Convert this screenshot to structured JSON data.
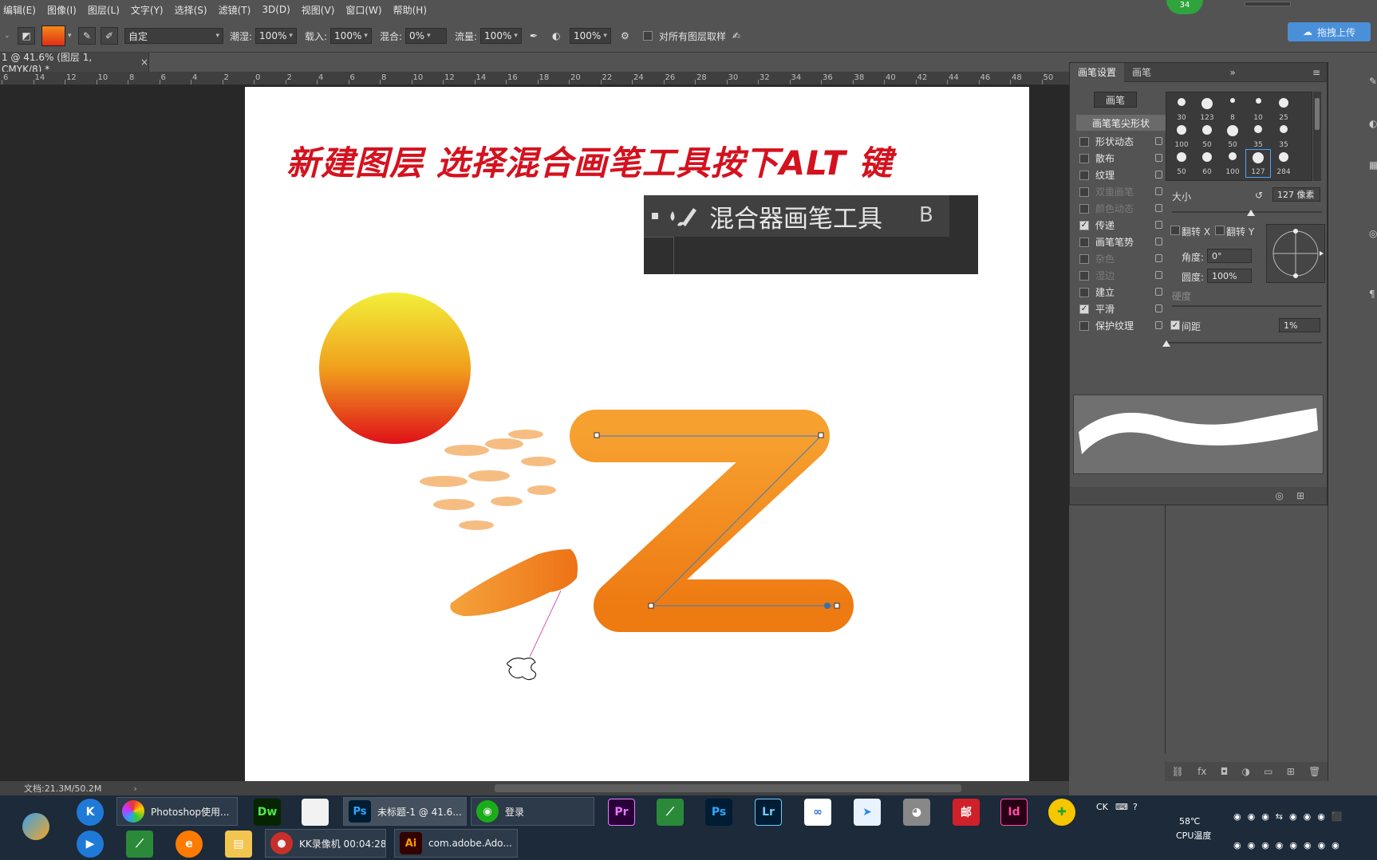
{
  "menu": [
    "编辑(E)",
    "图像(I)",
    "图层(L)",
    "文字(Y)",
    "选择(S)",
    "滤镜(T)",
    "3D(D)",
    "视图(V)",
    "窗口(W)",
    "帮助(H)"
  ],
  "net_badge": "34",
  "options": {
    "preset": "自定",
    "wet_label": "潮湿:",
    "wet_value": "100%",
    "load_label": "载入:",
    "load_value": "100%",
    "mix_label": "混合:",
    "mix_value": "0%",
    "flow_label": "流量:",
    "flow_value": "100%",
    "extra_value": "100%",
    "sample_all_label": "对所有图层取样",
    "upload_label": "拖拽上传"
  },
  "doc_tab": {
    "title": "1 @ 41.6% (图层 1, CMYK/8) *",
    "close": "×"
  },
  "ruler": [
    "6",
    "14",
    "12",
    "10",
    "8",
    "6",
    "4",
    "2",
    "0",
    "2",
    "4",
    "6",
    "8",
    "10",
    "12",
    "14",
    "16",
    "18",
    "20",
    "22",
    "24",
    "26",
    "28",
    "30",
    "32",
    "34",
    "36",
    "38",
    "40",
    "42",
    "44",
    "46",
    "48",
    "50"
  ],
  "canvas": {
    "headline": "新建图层   选择混合画笔工具按下ALT 键",
    "tooltip_label": "混合器画笔工具",
    "tooltip_key": "B"
  },
  "status": {
    "doc_size": "文档:21.3M/50.2M",
    "arrow": "›"
  },
  "brush_panel": {
    "tabs": [
      "画笔设置",
      "画笔"
    ],
    "preset_button": "画笔",
    "tip_shape": "画笔笔尖形状",
    "options": [
      {
        "label": "形状动态",
        "checked": false,
        "dim": false
      },
      {
        "label": "散布",
        "checked": false,
        "dim": false
      },
      {
        "label": "纹理",
        "checked": false,
        "dim": false
      },
      {
        "label": "双重画笔",
        "checked": false,
        "dim": true
      },
      {
        "label": "颜色动态",
        "checked": false,
        "dim": true
      },
      {
        "label": "传递",
        "checked": true,
        "dim": false
      },
      {
        "label": "画笔笔势",
        "checked": false,
        "dim": false
      },
      {
        "label": "杂色",
        "checked": false,
        "dim": true
      },
      {
        "label": "湿边",
        "checked": false,
        "dim": true
      },
      {
        "label": "建立",
        "checked": false,
        "dim": false
      },
      {
        "label": "平滑",
        "checked": true,
        "dim": false
      },
      {
        "label": "保护纹理",
        "checked": false,
        "dim": false
      }
    ],
    "presets": [
      "30",
      "123",
      "8",
      "10",
      "25",
      "100",
      "50",
      "50",
      "35",
      "35",
      "50",
      "60",
      "100",
      "127",
      "284"
    ],
    "size_label": "大小",
    "size_value": "127 像素",
    "flip_x": "翻转 X",
    "flip_y": "翻转 Y",
    "angle_label": "角度:",
    "angle_value": "0°",
    "roundness_label": "圆度:",
    "roundness_value": "100%",
    "hardness_label": "硬度",
    "spacing_label": "间距",
    "spacing_value": "1%"
  },
  "taskbar": {
    "row1": [
      {
        "label": "Photoshop使用...",
        "icon": "photoshop-use-icon"
      },
      {
        "label": "未标题-1 @ 41.6...",
        "icon": "ps-icon"
      },
      {
        "label": "登录",
        "icon": "wechat-icon"
      }
    ],
    "row2": [
      {
        "label": "KK录像机 00:04:28",
        "icon": "kk-recorder-icon"
      },
      {
        "label": "com.adobe.Ado...",
        "icon": "ai-icon"
      }
    ],
    "apps": [
      "Dw",
      "Pr",
      "Ps",
      "Lr",
      "Id"
    ],
    "temp": "58℃",
    "cpu": "CPU温度",
    "lang": "CK"
  },
  "colors": {
    "accent": "#d4121f",
    "orange": "#f08a1a",
    "panel": "#535353"
  }
}
